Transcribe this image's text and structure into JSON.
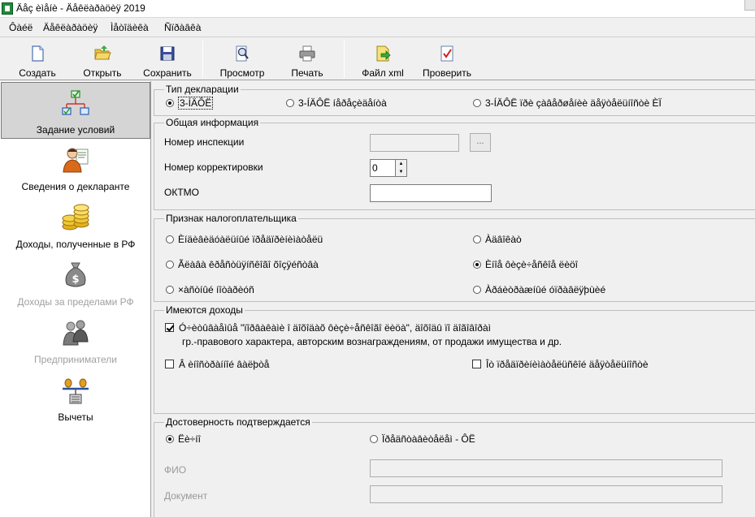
{
  "window": {
    "title": "Äåç èìåíè - Äåêëàðàöèÿ 2019"
  },
  "menu": [
    "Ôàéë",
    "Äåêëàðàöèÿ",
    "Ìåòîäèêà",
    "Ñïðàâêà"
  ],
  "toolbar": {
    "create": "Создать",
    "open": "Открыть",
    "save": "Сохранить",
    "preview": "Просмотр",
    "print": "Печать",
    "xml": "Файл xml",
    "check": "Проверить"
  },
  "nav": {
    "conditions": "Задание условий",
    "declarant": "Сведения о декларанте",
    "income_rf": "Доходы, полученные в РФ",
    "income_abroad": "Доходы за пределами РФ",
    "entrepreneurs": "Предприниматели",
    "deductions": "Вычеты"
  },
  "decl_type": {
    "title": "Тип декларации",
    "opt1": "3-ÍÄÔË",
    "opt2": "3-ÍÄÔË íåðåçèäåíòà",
    "opt3": "3-ÍÄÔË ïðè çàâåðøåíèè äåÿòåëüíîñòè ÈÏ"
  },
  "general": {
    "title": "Общая информация",
    "inspection_label": "Номер инспекции",
    "inspection_value": "",
    "browse": "...",
    "correction_label": "Номер корректировки",
    "correction_value": "0",
    "oktmo_label": "ОКТМО",
    "oktmo_value": ""
  },
  "taxpayer": {
    "title": "Признак налогоплательщика",
    "opt1": "Èíäèâèäóàëüíûé ïðåäïðèíèìàòåëü",
    "opt2": "Àäâîêàò",
    "opt3": "Ãëàâà êðåñòüÿíñêîãî õîçÿéñòâà",
    "opt4": "Èíîå ôèçè÷åñêîå ëèöî",
    "opt5": "×àñòíûé íîòàðèóñ",
    "opt6": "Àðáèòðàæíûé óïðàâëÿþùèé"
  },
  "income": {
    "title": "Имеются доходы",
    "check1_line1": "Ó÷èòûâàåìûå \"ïîðâàêàìè î äîõîäàõ ôèçè÷åñêîãî ëèöà\", äîõîäû ïî äîãîâîðàì",
    "check1_line2": "гр.-правового характера, авторским вознаграждениям, от продажи имущества и др.",
    "check2": "Â èíîñòðàííîé âàëþòå",
    "check3": "Îò ïðåäïðèíèìàòåëüñêîé äåÿòåëüíîñòè"
  },
  "confirm": {
    "title": "Достоверность подтверждается",
    "opt1": "Ëè÷íî",
    "opt2": "Ïðåäñòàâèòåëåì - ÔË",
    "fio_label": "ФИО",
    "doc_label": "Документ"
  }
}
